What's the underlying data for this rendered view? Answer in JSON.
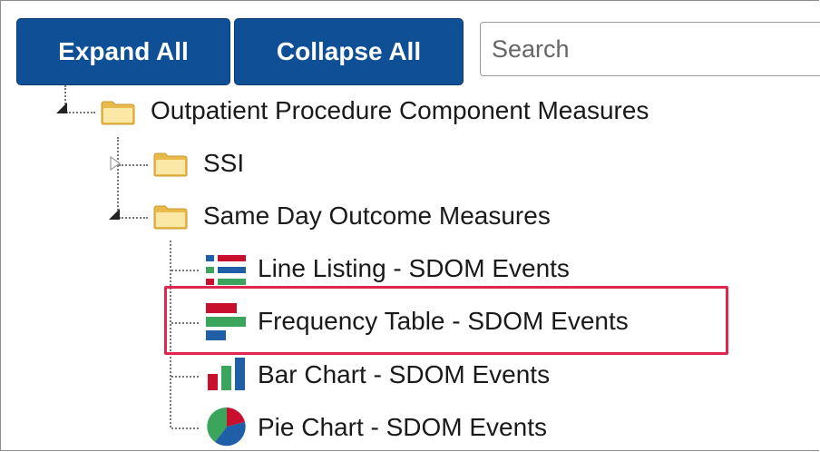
{
  "toolbar": {
    "expand_all_label": "Expand All",
    "collapse_all_label": "Collapse All",
    "search_placeholder": "Search"
  },
  "tree": {
    "root": {
      "label": "Outpatient Procedure Component Measures",
      "icon": "folder-icon",
      "expanded": true
    },
    "folders": [
      {
        "label": "SSI",
        "icon": "folder-icon",
        "expanded": false
      },
      {
        "label": "Same Day Outcome Measures",
        "icon": "folder-icon",
        "expanded": true
      }
    ],
    "reports": [
      {
        "label": "Line Listing - SDOM Events",
        "icon": "line-listing-icon"
      },
      {
        "label": "Frequency Table - SDOM Events",
        "icon": "frequency-table-icon",
        "highlighted": true
      },
      {
        "label": "Bar Chart - SDOM Events",
        "icon": "bar-chart-icon"
      },
      {
        "label": "Pie Chart - SDOM Events",
        "icon": "pie-chart-icon"
      }
    ]
  },
  "colors": {
    "button_bg": "#0e4f96",
    "highlight_border": "#e0254f",
    "icon_red": "#c8102e",
    "icon_green": "#3ba55c",
    "icon_blue": "#1f5fa8"
  }
}
